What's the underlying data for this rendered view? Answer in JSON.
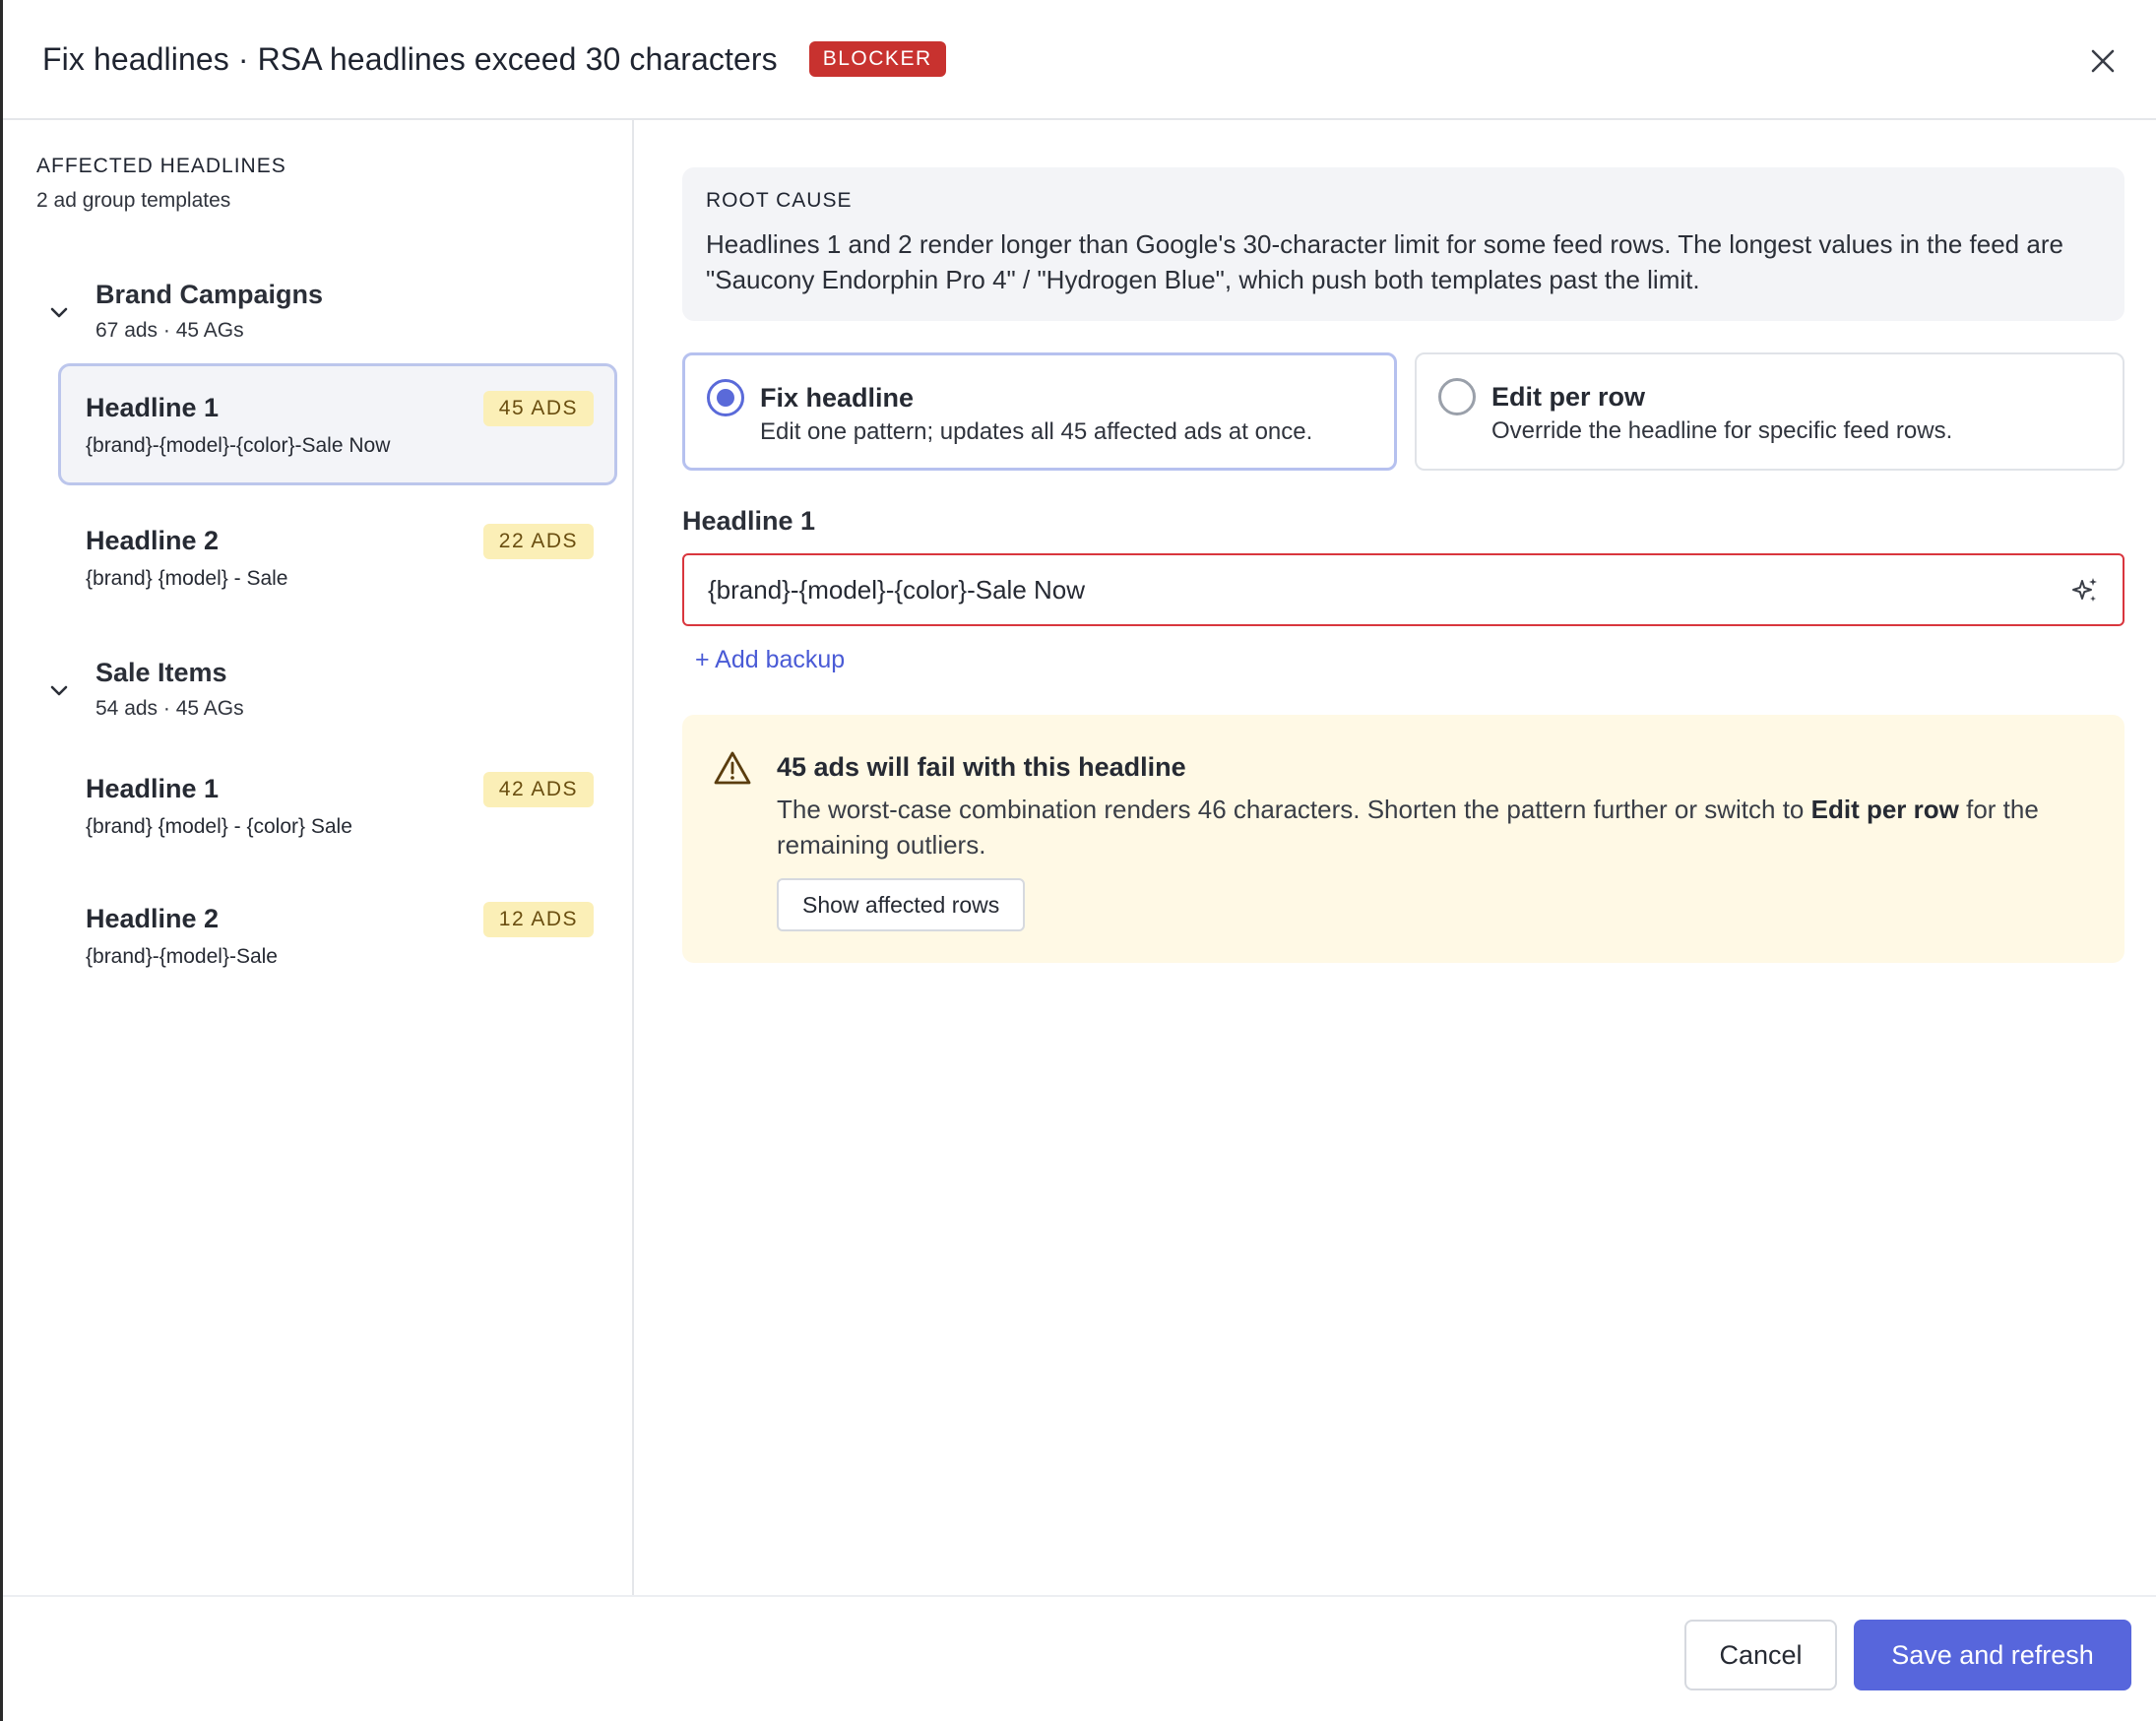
{
  "header": {
    "title": "Fix headlines · RSA headlines exceed 30 characters",
    "badge": "BLOCKER"
  },
  "sidebar": {
    "heading": "AFFECTED HEADLINES",
    "subheading": "2 ad group templates",
    "groups": [
      {
        "name": "Brand Campaigns",
        "meta": "67 ads · 45 AGs",
        "items": [
          {
            "title": "Headline 1",
            "badge": "45 ADS",
            "pattern": "{brand}-{model}-{color}-Sale Now",
            "selected": true
          },
          {
            "title": "Headline 2",
            "badge": "22 ADS",
            "pattern": "{brand} {model} - Sale",
            "selected": false
          }
        ]
      },
      {
        "name": "Sale Items",
        "meta": "54 ads · 45 AGs",
        "items": [
          {
            "title": "Headline 1",
            "badge": "42 ADS",
            "pattern": "{brand} {model} - {color} Sale",
            "selected": false
          },
          {
            "title": "Headline 2",
            "badge": "12 ADS",
            "pattern": "{brand}-{model}-Sale",
            "selected": false
          }
        ]
      }
    ]
  },
  "main": {
    "root_cause": {
      "label": "ROOT CAUSE",
      "text": "Headlines 1 and 2 render longer than Google's 30-character limit for some feed rows. The longest values in the feed are \"Saucony Endorphin Pro 4\" / \"Hydrogen Blue\", which push both templates past the limit."
    },
    "options": [
      {
        "title": "Fix headline",
        "desc": "Edit one pattern; updates all 45 affected ads at once.",
        "selected": true
      },
      {
        "title": "Edit per row",
        "desc": "Override the headline for specific feed rows.",
        "selected": false
      }
    ],
    "field": {
      "label": "Headline 1",
      "value": "{brand}-{model}-{color}-Sale Now"
    },
    "add_backup": "+ Add backup",
    "warning": {
      "title": "45 ads will fail with this headline",
      "text_before": "The worst-case combination renders 46 characters. Shorten the pattern further or switch to ",
      "text_bold": "Edit per row",
      "text_after": " for the remaining outliers.",
      "button": "Show affected rows"
    }
  },
  "footer": {
    "cancel": "Cancel",
    "save": "Save and refresh"
  },
  "colors": {
    "accent": "#5766dc",
    "blocker": "#c8322f",
    "badge_bg": "#fbefb7",
    "error_border": "#d9363e",
    "warning_bg": "#fff9e5"
  },
  "icons": [
    "close-icon",
    "chevron-down-icon",
    "sparkle-icon",
    "warning-icon"
  ]
}
